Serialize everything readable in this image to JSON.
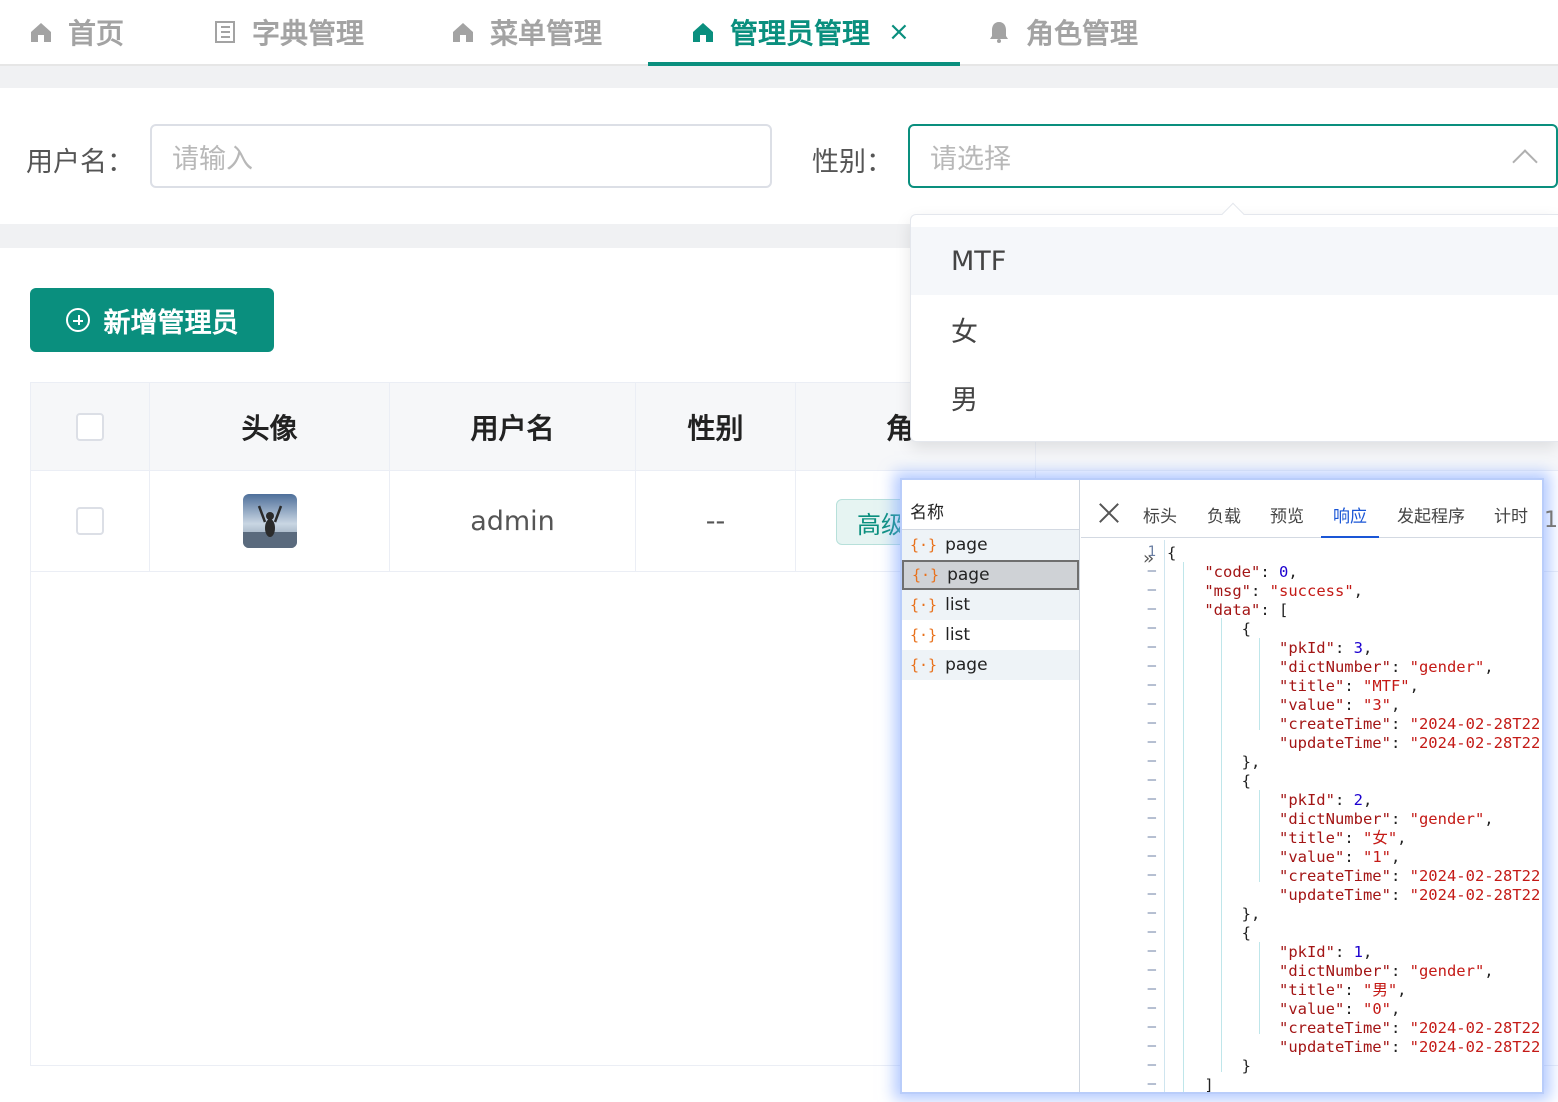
{
  "tabs": [
    {
      "label": "首页",
      "icon": "home-icon"
    },
    {
      "label": "字典管理",
      "icon": "document-icon"
    },
    {
      "label": "菜单管理",
      "icon": "home-icon"
    },
    {
      "label": "管理员管理",
      "icon": "home-icon",
      "active": true,
      "close": "×"
    },
    {
      "label": "角色管理",
      "icon": "bell-icon"
    }
  ],
  "search": {
    "username_label": "用户名：",
    "username_placeholder": "请输入",
    "gender_label": "性别：",
    "gender_placeholder": "请选择"
  },
  "dropdown": {
    "options": [
      "MTF",
      "女",
      "男"
    ]
  },
  "toolbar": {
    "add_label": "新增管理员"
  },
  "table": {
    "headers": [
      "头像",
      "用户名",
      "性别",
      "角"
    ],
    "rows": [
      {
        "username": "admin",
        "gender": "--",
        "role_tag": "高级"
      }
    ]
  },
  "devtools": {
    "name_header": "名称",
    "requests": [
      "page",
      "page",
      "list",
      "list",
      "page"
    ],
    "tabs": [
      "标头",
      "负载",
      "预览",
      "响应",
      "发起程序",
      "计时"
    ],
    "active_tab": "响应",
    "response_lines": [
      "{",
      "    \"code\": 0,",
      "    \"msg\": \"success\",",
      "    \"data\": [",
      "        {",
      "            \"pkId\": 3,",
      "            \"dictNumber\": \"gender\",",
      "            \"title\": \"MTF\",",
      "            \"value\": \"3\",",
      "            \"createTime\": \"2024-02-28T22",
      "            \"updateTime\": \"2024-02-28T22",
      "        },",
      "        {",
      "            \"pkId\": 2,",
      "            \"dictNumber\": \"gender\",",
      "            \"title\": \"女\",",
      "            \"value\": \"1\",",
      "            \"createTime\": \"2024-02-28T22",
      "            \"updateTime\": \"2024-02-28T22",
      "        },",
      "        {",
      "            \"pkId\": 1,",
      "            \"dictNumber\": \"gender\",",
      "            \"title\": \"男\",",
      "            \"value\": \"0\",",
      "            \"createTime\": \"2024-02-28T22",
      "            \"updateTime\": \"2024-02-28T22",
      "        }",
      "    ]"
    ],
    "first_line_number": "1",
    "gutter_dash": "–",
    "fold_marker": "»"
  },
  "side_number": "1",
  "colors": {
    "accent": "#0a8f7e",
    "devtools_active": "#1a56d6"
  }
}
